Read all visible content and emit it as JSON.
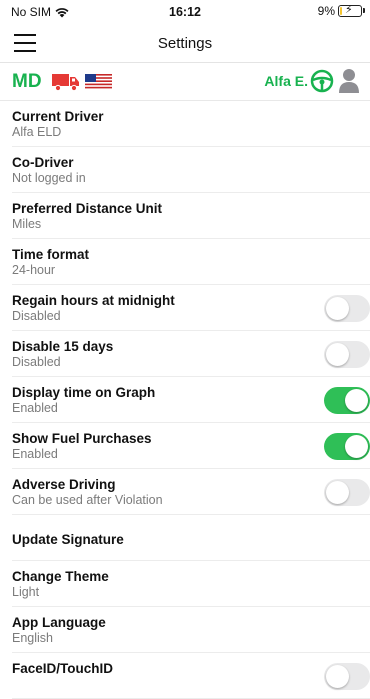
{
  "status_bar": {
    "carrier": "No SIM",
    "time": "16:12",
    "battery": "9%",
    "battery_level": 0.09
  },
  "nav": {
    "title": "Settings",
    "menu_icon": "hamburger-menu-icon"
  },
  "info_bar": {
    "state": "MD",
    "driver": "Alfa E.",
    "truck_color": "#e53935",
    "accent": "#18b24f"
  },
  "settings": [
    {
      "title": "Current Driver",
      "subtitle": "Alfa ELD"
    },
    {
      "title": "Co-Driver",
      "subtitle": "Not logged in"
    },
    {
      "title": "Preferred Distance Unit",
      "subtitle": "Miles"
    },
    {
      "title": "Time format",
      "subtitle": "24-hour"
    },
    {
      "title": "Regain hours at midnight",
      "subtitle": "Disabled",
      "toggle": false
    },
    {
      "title": "Disable 15 days",
      "subtitle": "Disabled",
      "toggle": false
    },
    {
      "title": "Display time on Graph",
      "subtitle": "Enabled",
      "toggle": true
    },
    {
      "title": "Show Fuel Purchases",
      "subtitle": "Enabled",
      "toggle": true
    },
    {
      "title": "Adverse Driving",
      "subtitle": "Can be used after Violation",
      "toggle": false
    },
    {
      "title": "Update Signature",
      "subtitle": ""
    },
    {
      "title": "Change Theme",
      "subtitle": "Light"
    },
    {
      "title": "App Language",
      "subtitle": "English"
    },
    {
      "title": "FaceID/TouchID",
      "subtitle": "",
      "toggle": false
    }
  ],
  "colors": {
    "toggle_on": "#2fbf57",
    "toggle_off": "#e9e9ea"
  }
}
